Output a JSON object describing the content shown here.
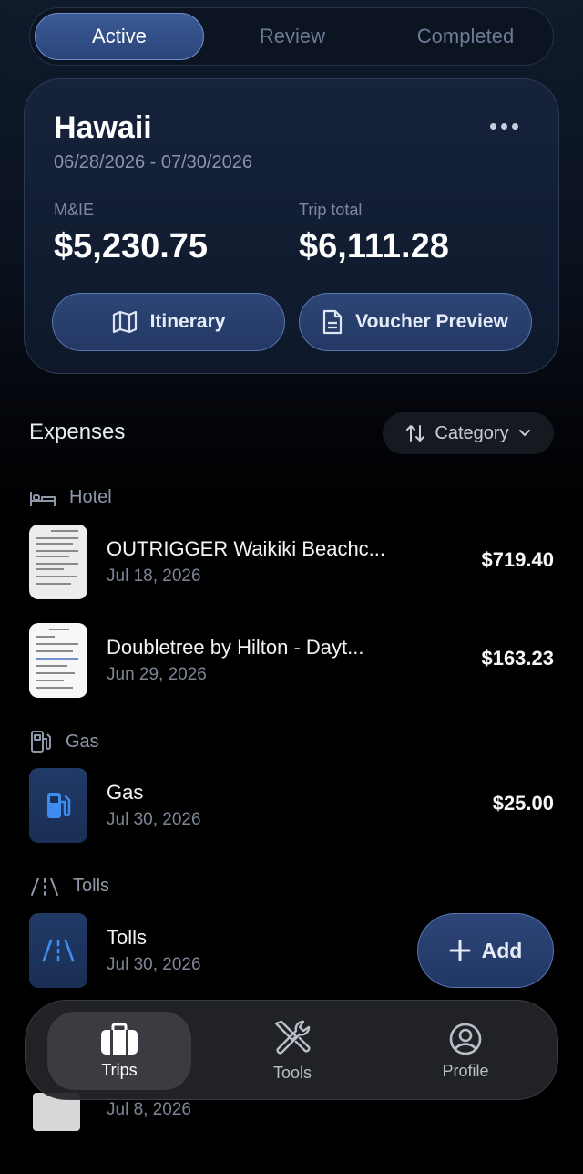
{
  "tabs": [
    {
      "label": "Active",
      "active": true
    },
    {
      "label": "Review",
      "active": false
    },
    {
      "label": "Completed",
      "active": false
    }
  ],
  "trip": {
    "name": "Hawaii",
    "dates": "06/28/2026 - 07/30/2026",
    "mie_label": "M&IE",
    "mie_value": "$5,230.75",
    "total_label": "Trip total",
    "total_value": "$6,111.28",
    "itinerary_label": "Itinerary",
    "voucher_label": "Voucher Preview"
  },
  "expenses": {
    "title": "Expenses",
    "sort_label": "Category",
    "groups": [
      {
        "name": "Hotel",
        "items": [
          {
            "title": "OUTRIGGER Waikiki Beachc...",
            "date": "Jul 18, 2026",
            "amount": "$719.40"
          },
          {
            "title": "Doubletree by Hilton - Dayt...",
            "date": "Jun 29, 2026",
            "amount": "$163.23"
          }
        ]
      },
      {
        "name": "Gas",
        "items": [
          {
            "title": "Gas",
            "date": "Jul 30, 2026",
            "amount": "$25.00"
          }
        ]
      },
      {
        "name": "Tolls",
        "items": [
          {
            "title": "Tolls",
            "date": "Jul 30, 2026",
            "amount": ""
          }
        ]
      }
    ],
    "partial_item_date": "Jul 8, 2026"
  },
  "fab": {
    "label": "Add"
  },
  "tabbar": [
    {
      "label": "Trips",
      "icon": "briefcase-icon",
      "active": true
    },
    {
      "label": "Tools",
      "icon": "tools-icon",
      "active": false
    },
    {
      "label": "Profile",
      "icon": "profile-icon",
      "active": false
    }
  ],
  "colors": {
    "accent": "#2e4677",
    "accent_border": "#5775b0",
    "icon_blue": "#3f8cf0"
  }
}
